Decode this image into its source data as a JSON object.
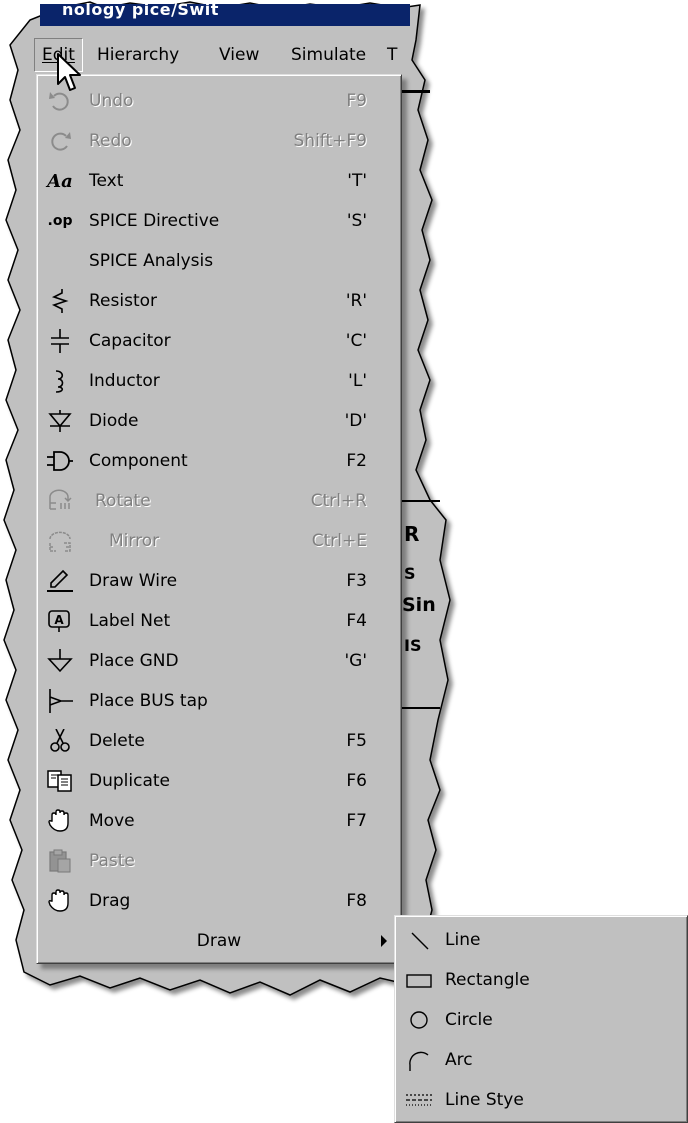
{
  "title_fragment": "nology  pice/Swit",
  "menubar": {
    "items": [
      {
        "label": "Edit",
        "access": "E"
      },
      {
        "label": "Hierarchy",
        "access": "i"
      },
      {
        "label": "View",
        "access": "V"
      },
      {
        "label": "Simulate",
        "access": "S"
      },
      {
        "label": "T",
        "access": "T"
      }
    ]
  },
  "schematic_fragments": [
    "R",
    "S",
    "Sin",
    "IS"
  ],
  "edit_menu": {
    "items": [
      {
        "label": "Undo",
        "shortcut": "F9",
        "icon": "undo-icon",
        "enabled": false
      },
      {
        "label": "Redo",
        "shortcut": "Shift+F9",
        "icon": "redo-icon",
        "enabled": false
      },
      {
        "label": "Text",
        "shortcut": "'T'",
        "icon": "text-icon",
        "enabled": true
      },
      {
        "label": "SPICE Directive",
        "shortcut": "'S'",
        "icon": "spice-directive-icon",
        "enabled": true
      },
      {
        "label": "SPICE Analysis",
        "shortcut": "",
        "icon": "",
        "enabled": true
      },
      {
        "label": "Resistor",
        "shortcut": "'R'",
        "icon": "resistor-icon",
        "enabled": true
      },
      {
        "label": "Capacitor",
        "shortcut": "'C'",
        "icon": "capacitor-icon",
        "enabled": true
      },
      {
        "label": "Inductor",
        "shortcut": "'L'",
        "icon": "inductor-icon",
        "enabled": true
      },
      {
        "label": "Diode",
        "shortcut": "'D'",
        "icon": "diode-icon",
        "enabled": true
      },
      {
        "label": "Component",
        "shortcut": "F2",
        "icon": "component-icon",
        "enabled": true
      },
      {
        "label": "Rotate",
        "shortcut": "Ctrl+R",
        "icon": "rotate-icon",
        "enabled": false
      },
      {
        "label": "Mirror",
        "shortcut": "Ctrl+E",
        "icon": "mirror-icon",
        "enabled": false
      },
      {
        "label": "Draw Wire",
        "shortcut": "F3",
        "icon": "draw-wire-icon",
        "enabled": true
      },
      {
        "label": "Label Net",
        "shortcut": "F4",
        "icon": "label-net-icon",
        "enabled": true
      },
      {
        "label": "Place GND",
        "shortcut": "'G'",
        "icon": "ground-icon",
        "enabled": true
      },
      {
        "label": "Place BUS tap",
        "shortcut": "",
        "icon": "bus-tap-icon",
        "enabled": true
      },
      {
        "label": "Delete",
        "shortcut": "F5",
        "icon": "scissors-icon",
        "enabled": true
      },
      {
        "label": "Duplicate",
        "shortcut": "F6",
        "icon": "duplicate-icon",
        "enabled": true
      },
      {
        "label": "Move",
        "shortcut": "F7",
        "icon": "move-hand-icon",
        "enabled": true
      },
      {
        "label": "Paste",
        "shortcut": "",
        "icon": "paste-icon",
        "enabled": false
      },
      {
        "label": "Drag",
        "shortcut": "F8",
        "icon": "drag-hand-icon",
        "enabled": true
      },
      {
        "label": "Draw",
        "shortcut": "",
        "icon": "",
        "enabled": true
      }
    ]
  },
  "draw_submenu": {
    "items": [
      {
        "label": "Line",
        "icon": "line-icon"
      },
      {
        "label": "Rectangle",
        "icon": "rectangle-icon"
      },
      {
        "label": "Circle",
        "icon": "circle-icon"
      },
      {
        "label": "Arc",
        "icon": "arc-icon"
      },
      {
        "label": "Line Stye",
        "icon": "line-style-icon"
      }
    ]
  },
  "colors": {
    "menu_bg": "#c0c0c0",
    "disabled_text": "#808080"
  }
}
